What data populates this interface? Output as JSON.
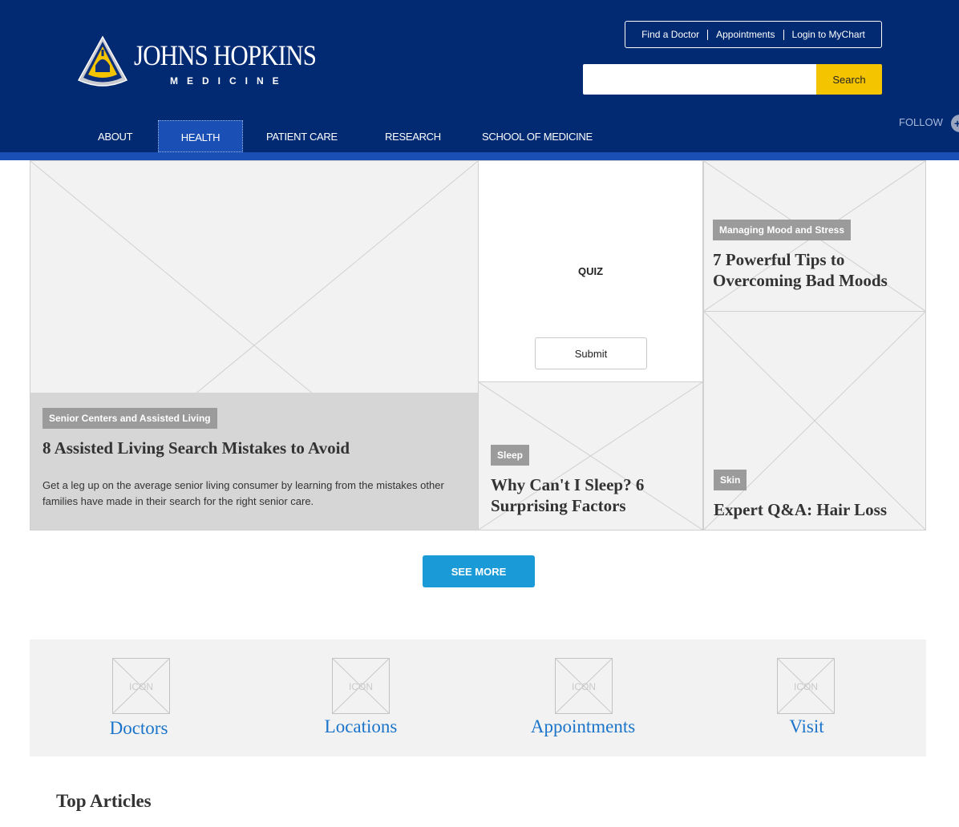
{
  "header": {
    "logo": {
      "name": "JOHNS HOPKINS",
      "sub": "MEDICINE"
    },
    "utility_links": [
      "Find a Doctor",
      "Appointments",
      "Login to MyChart"
    ],
    "search": {
      "placeholder": "",
      "button_label": "Search"
    },
    "follow_label": "FOLLOW",
    "nav": [
      {
        "label": "ABOUT",
        "active": false
      },
      {
        "label": "HEALTH",
        "active": true
      },
      {
        "label": "PATIENT CARE",
        "active": false
      },
      {
        "label": "RESEARCH",
        "active": false
      },
      {
        "label": "SCHOOL OF MEDICINE",
        "active": false
      }
    ]
  },
  "feature": {
    "tag": "Senior Centers and Assisted Living",
    "title": "8 Assisted Living Search Mistakes to Avoid",
    "description": "Get a leg up on the average senior living consumer by learning from the mistakes other families have made in their search for the right senior care."
  },
  "quiz": {
    "label": "QUIZ",
    "submit_label": "Submit"
  },
  "cards": {
    "mood": {
      "tag": "Managing Mood and Stress",
      "title": "7 Powerful Tips to Overcoming Bad Moods"
    },
    "sleep": {
      "tag": "Sleep",
      "title": "Why Can't I Sleep? 6 Surprising Factors"
    },
    "skin": {
      "tag": "Skin",
      "title": "Expert Q&A: Hair Loss"
    }
  },
  "see_more_label": "SEE MORE",
  "quick_links": {
    "icon_placeholder": "ICON",
    "items": [
      "Doctors",
      "Locations",
      "Appointments",
      "Visit"
    ]
  },
  "top_articles_heading": "Top Articles",
  "colors": {
    "header_bg": "#012a72",
    "nav_active": "#1a4fb5",
    "search_button": "#f5c400",
    "see_more": "#1a9ad6",
    "link_blue": "#1a74c9",
    "tag_gray": "#9b9b9b"
  }
}
